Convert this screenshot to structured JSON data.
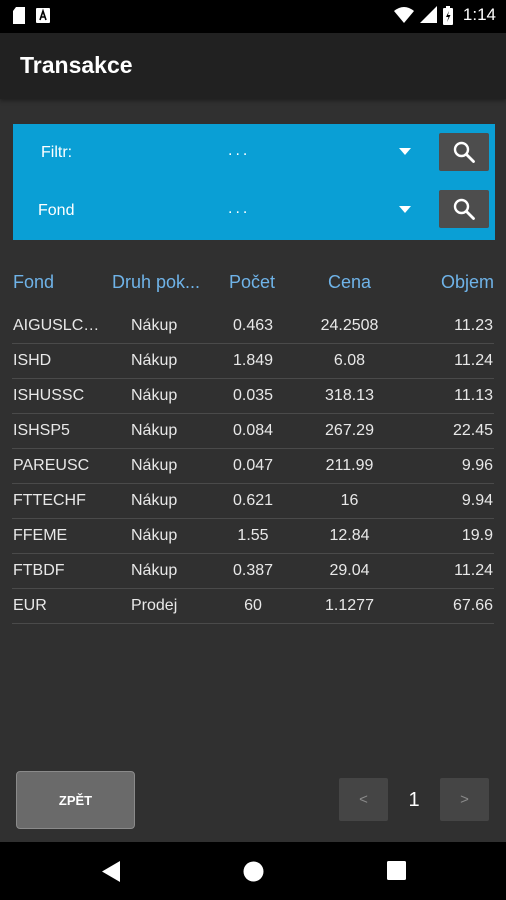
{
  "status_bar": {
    "time": "1:14",
    "left_icons": [
      "sd-card-icon",
      "a-notification-icon"
    ],
    "right_icons": [
      "wifi-icon",
      "signal-icon",
      "battery-icon"
    ]
  },
  "app_bar": {
    "title": "Transakce"
  },
  "filters": {
    "filter_label": "Filtr:",
    "filter_value": "...",
    "fund_label": "Fond",
    "fund_value": "...",
    "panel_color": "#0a9fd5"
  },
  "table": {
    "headers": {
      "fond": "Fond",
      "druh": "Druh pok...",
      "pocet": "Počet",
      "cena": "Cena",
      "objem": "Objem"
    },
    "rows": [
      {
        "fond": "AIGUSLCR...",
        "druh": "Nákup",
        "pocet": "0.463",
        "cena": "24.2508",
        "objem": "11.23"
      },
      {
        "fond": "ISHD",
        "druh": "Nákup",
        "pocet": "1.849",
        "cena": "6.08",
        "objem": "11.24"
      },
      {
        "fond": "ISHUSSC",
        "druh": "Nákup",
        "pocet": "0.035",
        "cena": "318.13",
        "objem": "11.13"
      },
      {
        "fond": "ISHSP5",
        "druh": "Nákup",
        "pocet": "0.084",
        "cena": "267.29",
        "objem": "22.45"
      },
      {
        "fond": "PAREUSC",
        "druh": "Nákup",
        "pocet": "0.047",
        "cena": "211.99",
        "objem": "9.96"
      },
      {
        "fond": "FTTECHF",
        "druh": "Nákup",
        "pocet": "0.621",
        "cena": "16",
        "objem": "9.94"
      },
      {
        "fond": "FFEME",
        "druh": "Nákup",
        "pocet": "1.55",
        "cena": "12.84",
        "objem": "19.9"
      },
      {
        "fond": "FTBDF",
        "druh": "Nákup",
        "pocet": "0.387",
        "cena": "29.04",
        "objem": "11.24"
      },
      {
        "fond": "EUR",
        "druh": "Prodej",
        "pocet": "60",
        "cena": "1.1277",
        "objem": "67.66"
      }
    ]
  },
  "footer": {
    "back_label": "ZPĚT",
    "prev_label": "<",
    "next_label": ">",
    "page": "1"
  },
  "nav_bar": {
    "icons": [
      "back-triangle-icon",
      "home-circle-icon",
      "recents-square-icon"
    ]
  }
}
